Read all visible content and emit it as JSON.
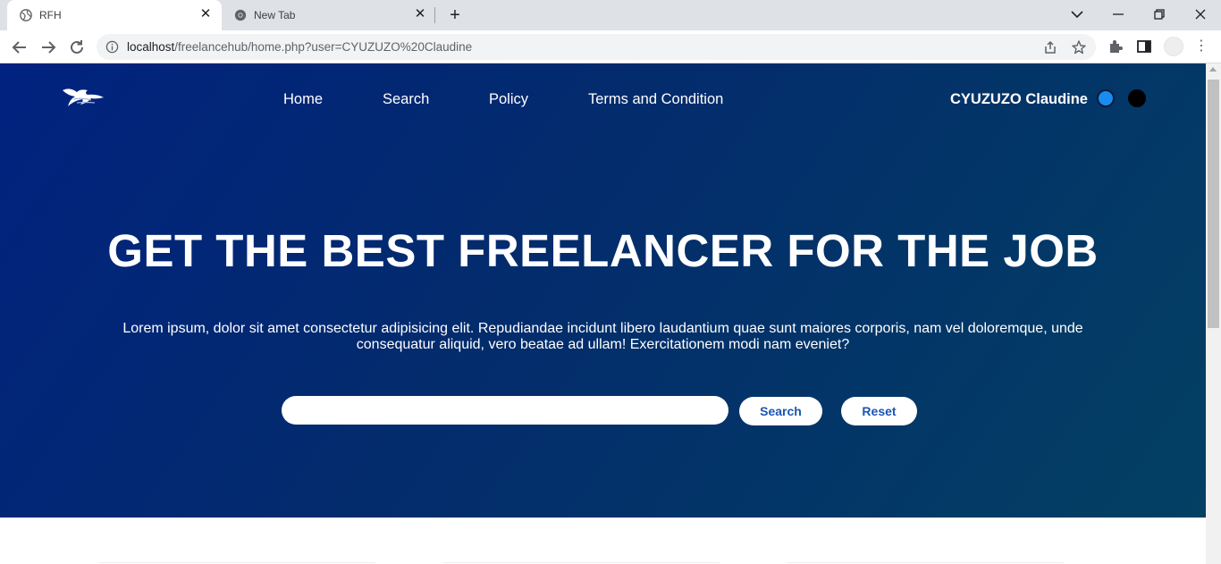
{
  "browser": {
    "tabs": [
      {
        "title": "RFH",
        "icon": "globe-icon",
        "active": true
      },
      {
        "title": "New Tab",
        "icon": "chrome-icon",
        "active": false
      }
    ],
    "url_host": "localhost",
    "url_path": "/freelancehub/home.php?user=CYUZUZO%20Claudine"
  },
  "header": {
    "nav": [
      "Home",
      "Search",
      "Policy",
      "Terms and Condition"
    ],
    "username": "CYUZUZO Claudine"
  },
  "hero": {
    "headline": "GET THE BEST FREELANCER FOR THE JOB",
    "lead": "Lorem ipsum, dolor sit amet consectetur adipisicing elit. Repudiandae incidunt libero laudantium quae sunt maiores corporis, nam vel doloremque, unde consequatur aliquid, vero beatae ad ullam! Exercitationem modi nam eveniet?",
    "search_value": "",
    "search_button": "Search",
    "reset_button": "Reset"
  },
  "colors": {
    "hero_gradient_start": "#01227f",
    "hero_gradient_end": "#034063",
    "button_text": "#1a55b5",
    "theme_dot_blue": "#1a8cf0",
    "theme_dot_black": "#000000"
  }
}
